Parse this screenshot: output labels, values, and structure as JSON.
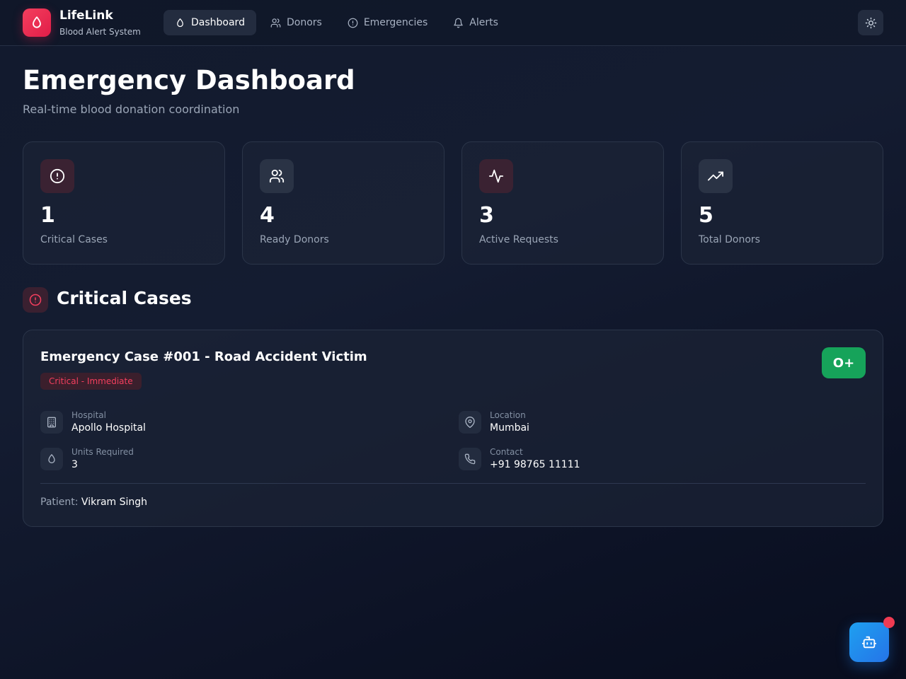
{
  "header": {
    "brand_name": "LifeLink",
    "brand_subtitle": "Blood Alert System",
    "nav": [
      {
        "label": "Dashboard",
        "icon": "droplet-icon",
        "active": true
      },
      {
        "label": "Donors",
        "icon": "users-icon",
        "active": false
      },
      {
        "label": "Emergencies",
        "icon": "alert-circle-icon",
        "active": false
      },
      {
        "label": "Alerts",
        "icon": "bell-icon",
        "active": false
      }
    ],
    "theme_toggle_icon": "sun-icon"
  },
  "page": {
    "title": "Emergency Dashboard",
    "subtitle": "Real-time blood donation coordination"
  },
  "stats": [
    {
      "value": "1",
      "label": "Critical Cases",
      "icon": "alert-circle-icon"
    },
    {
      "value": "4",
      "label": "Ready Donors",
      "icon": "users-icon"
    },
    {
      "value": "3",
      "label": "Active Requests",
      "icon": "activity-icon"
    },
    {
      "value": "5",
      "label": "Total Donors",
      "icon": "trending-up-icon"
    }
  ],
  "critical_section": {
    "title": "Critical Cases",
    "icon": "alert-circle-icon"
  },
  "case": {
    "title": "Emergency Case #001 - Road Accident Victim",
    "badge": "Critical - Immediate",
    "blood_type": "O+",
    "hospital_label": "Hospital",
    "hospital_value": "Apollo Hospital",
    "location_label": "Location",
    "location_value": "Mumbai",
    "units_label": "Units Required",
    "units_value": "3",
    "contact_label": "Contact",
    "contact_value": "+91 98765 11111",
    "patient_label": "Patient:",
    "patient_name": "Vikram Singh"
  },
  "assistant_button_icon": "bot-icon",
  "colors": {
    "accent_red": "#e11d48",
    "success_green": "#16a35a",
    "assistant_blue": "#2574e8"
  }
}
